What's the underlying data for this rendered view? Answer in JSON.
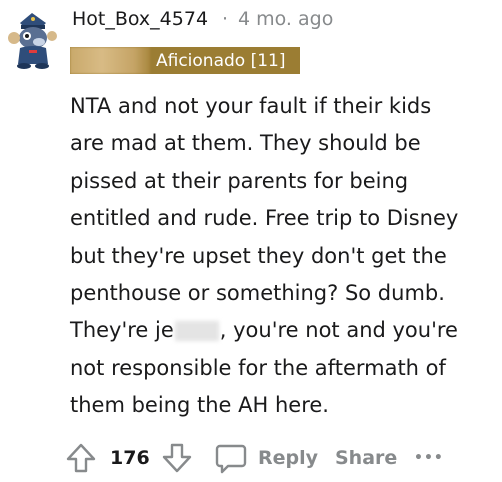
{
  "comment": {
    "author": "Hot_Box_4574",
    "separator": "·",
    "timestamp": "4 mo. ago",
    "flair": "Aficionado [11]",
    "body_lines": [
      "NTA and not your fault if their kids",
      "are mad at them. They should be",
      "pissed at their parents for being",
      "entitled and rude. Free trip to Disney",
      "but they're upset they don't get the",
      "penthouse or something? So dumb.",
      "They're je",
      ", you're not and you're",
      "not responsible for the aftermath of",
      "them being the AH here."
    ]
  },
  "actions": {
    "upvote_icon": "arrow-up-icon",
    "score": "176",
    "downvote_icon": "arrow-down-icon",
    "reply_icon": "speech-bubble-icon",
    "reply_label": "Reply",
    "share_label": "Share",
    "more_icon": "ellipsis-icon",
    "more_label": "•••"
  },
  "colors": {
    "text": "#1a1a1b",
    "meta": "#878a8c",
    "flair_bg": "#9b7d33"
  }
}
